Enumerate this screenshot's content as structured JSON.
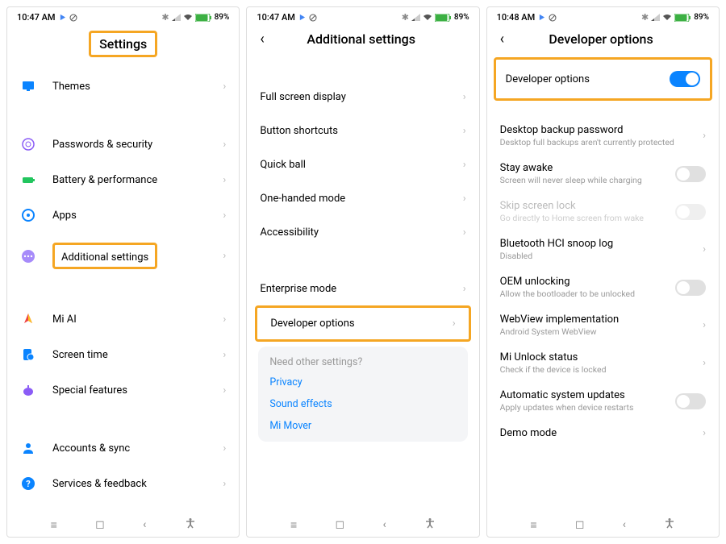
{
  "phone1": {
    "time": "10:47 AM",
    "battery": "89%",
    "title": "Settings",
    "rows": [
      {
        "label": "Themes"
      },
      {
        "label": "Passwords & security"
      },
      {
        "label": "Battery & performance"
      },
      {
        "label": "Apps"
      },
      {
        "label": "Additional settings"
      },
      {
        "label": "Mi AI"
      },
      {
        "label": "Screen time"
      },
      {
        "label": "Special features"
      },
      {
        "label": "Accounts & sync"
      },
      {
        "label": "Services & feedback"
      }
    ]
  },
  "phone2": {
    "time": "10:47 AM",
    "battery": "89%",
    "title": "Additional settings",
    "rows": [
      {
        "label": "Full screen display"
      },
      {
        "label": "Button shortcuts"
      },
      {
        "label": "Quick ball"
      },
      {
        "label": "One-handed mode"
      },
      {
        "label": "Accessibility"
      },
      {
        "label": "Enterprise mode"
      },
      {
        "label": "Developer options"
      }
    ],
    "other": {
      "heading": "Need other settings?",
      "links": [
        "Privacy",
        "Sound effects",
        "Mi Mover"
      ]
    }
  },
  "phone3": {
    "time": "10:48 AM",
    "battery": "89%",
    "title": "Developer options",
    "toggle_row": {
      "label": "Developer options"
    },
    "rows": [
      {
        "label": "Desktop backup password",
        "sub": "Desktop full backups aren't currently protected",
        "chevron": true
      },
      {
        "label": "Stay awake",
        "sub": "Screen will never sleep while charging",
        "toggle": true
      },
      {
        "label": "Skip screen lock",
        "sub": "Go directly to Home screen from wake",
        "toggle": true,
        "disabled": true
      },
      {
        "label": "Bluetooth HCI snoop log",
        "sub": "Disabled",
        "chevron": true
      },
      {
        "label": "OEM unlocking",
        "sub": "Allow the bootloader to be unlocked",
        "toggle": true
      },
      {
        "label": "WebView implementation",
        "sub": "Android System WebView",
        "chevron": true
      },
      {
        "label": "Mi Unlock status",
        "sub": "Check if the device is locked",
        "chevron": true
      },
      {
        "label": "Automatic system updates",
        "sub": "Apply updates when device restarts",
        "toggle": true
      },
      {
        "label": "Demo mode",
        "sub": "",
        "chevron": true
      }
    ]
  }
}
